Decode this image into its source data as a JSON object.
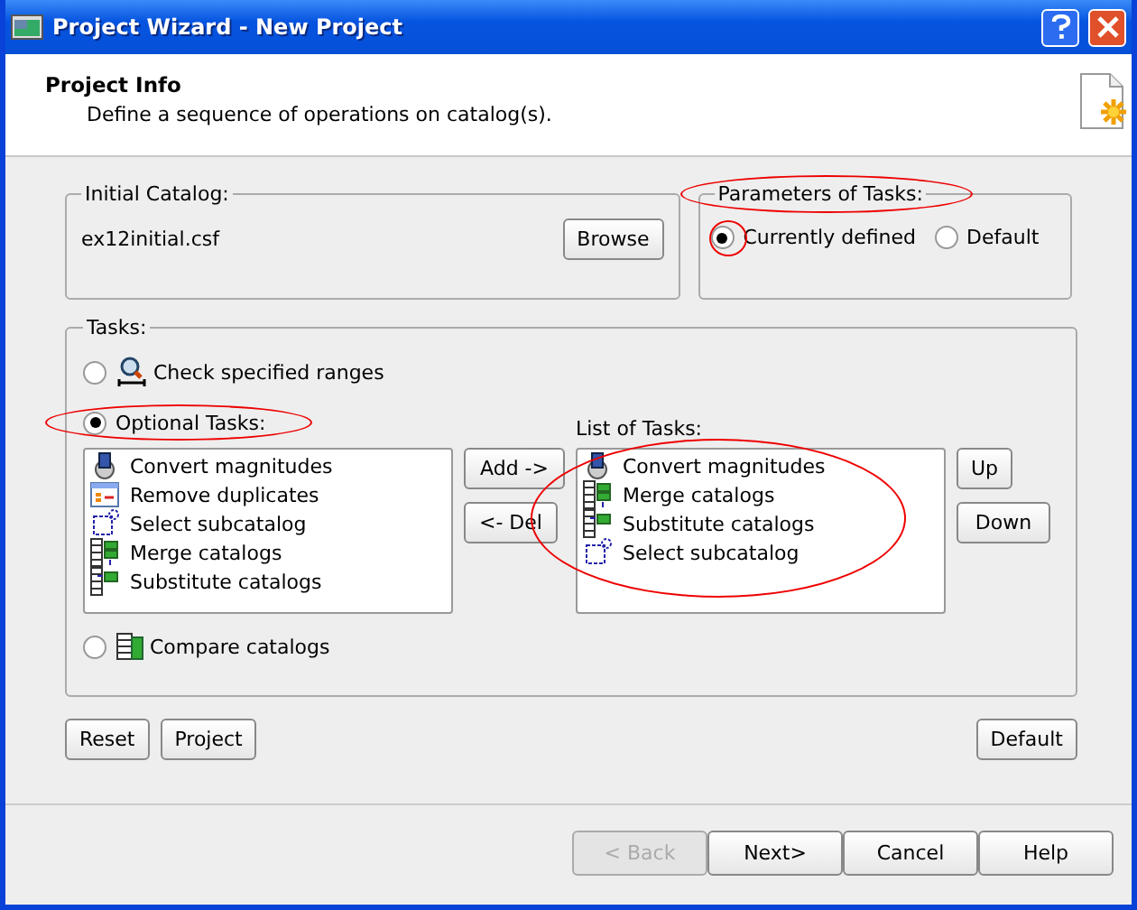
{
  "window": {
    "title": "Project Wizard - New Project"
  },
  "header": {
    "title": "Project Info",
    "subtitle": "Define a sequence of operations on catalog(s)."
  },
  "initial_catalog": {
    "legend": "Initial Catalog:",
    "file": "ex12initial.csf",
    "button": "Browse"
  },
  "parameters": {
    "legend": "Parameters of Tasks:",
    "options": [
      {
        "label": "Currently defined",
        "selected": true
      },
      {
        "label": "Default",
        "selected": false
      }
    ]
  },
  "tasks": {
    "legend": "Tasks:",
    "modes": [
      {
        "label": "Check specified ranges",
        "selected": false,
        "kind": "check"
      },
      {
        "label": "Optional Tasks:",
        "selected": true,
        "kind": "optional"
      },
      {
        "label": "Compare catalogs",
        "selected": false,
        "kind": "compare"
      }
    ],
    "optional_tasks": [
      {
        "label": "Convert magnitudes",
        "kind": "convert"
      },
      {
        "label": "Remove duplicates",
        "kind": "remove"
      },
      {
        "label": "Select subcatalog",
        "kind": "select"
      },
      {
        "label": "Merge catalogs",
        "kind": "merge"
      },
      {
        "label": "Substitute catalogs",
        "kind": "substitute"
      }
    ],
    "add_button": "Add ->",
    "del_button": "<- Del",
    "list_label": "List of Tasks:",
    "list_of_tasks": [
      {
        "label": "Convert magnitudes",
        "kind": "convert"
      },
      {
        "label": "Merge catalogs",
        "kind": "merge"
      },
      {
        "label": "Substitute catalogs",
        "kind": "substitute"
      },
      {
        "label": "Select subcatalog",
        "kind": "select"
      }
    ],
    "up_button": "Up",
    "down_button": "Down"
  },
  "actions": {
    "left": [
      "Reset",
      "Project"
    ],
    "right": "Default"
  },
  "nav": [
    {
      "label": "< Back",
      "disabled": true
    },
    {
      "label": "Next>",
      "disabled": false
    },
    {
      "label": "Cancel",
      "disabled": false
    },
    {
      "label": "Help",
      "disabled": false
    }
  ]
}
